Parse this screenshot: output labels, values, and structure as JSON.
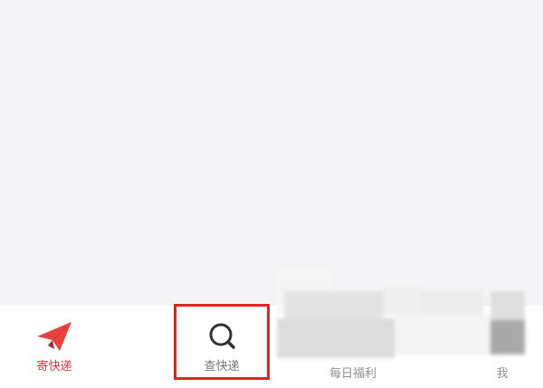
{
  "tabs": [
    {
      "id": "send",
      "label": "寄快递",
      "icon": "paper-plane-icon",
      "active": true
    },
    {
      "id": "query",
      "label": "查快递",
      "icon": "search-icon",
      "active": false
    },
    {
      "id": "daily",
      "label": "每日福利",
      "icon": "obscured-icon",
      "active": false
    },
    {
      "id": "me",
      "label": "我",
      "icon": "obscured-icon",
      "active": false
    }
  ],
  "colors": {
    "accent": "#d93a3a",
    "highlight": "#e02424",
    "content_bg": "#f4f4f7"
  }
}
